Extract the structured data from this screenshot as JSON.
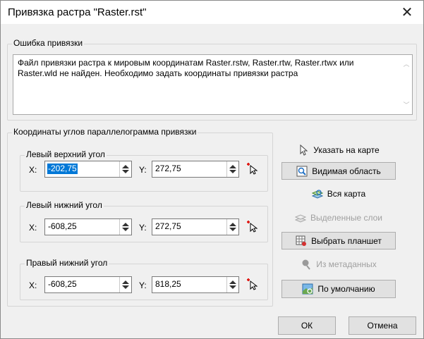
{
  "window": {
    "title": "Привязка растра \"Raster.rst\"",
    "close_label": "✕"
  },
  "error_group": {
    "legend": "Ошибка привязки",
    "message": "Файл привязки растра к мировым координатам Raster.rstw, Raster.rtw, Raster.rtwx или Raster.wld не найден.  Необходимо задать координаты привязки растра"
  },
  "coords_group": {
    "legend": "Координаты углов параллелограмма привязки",
    "corners": [
      {
        "legend": "Левый верхний угол",
        "x_label": "X:",
        "x_value": "-202,75",
        "y_label": "Y:",
        "y_value": "272,75"
      },
      {
        "legend": "Левый нижний угол",
        "x_label": "X:",
        "x_value": "-608,25",
        "y_label": "Y:",
        "y_value": "272,75"
      },
      {
        "legend": "Правый нижний угол",
        "x_label": "X:",
        "x_value": "-608,25",
        "y_label": "Y:",
        "y_value": "818,25"
      }
    ]
  },
  "buttons": {
    "point_on_map": "Указать на карте",
    "visible_area": "Видимая область",
    "whole_map": "Вся карта",
    "selected_layers": "Выделенные слои",
    "choose_sheet": "Выбрать планшет",
    "from_metadata": "Из метаданных",
    "default": "По умолчанию"
  },
  "footer": {
    "ok": "ОК",
    "cancel": "Отмена"
  },
  "colors": {
    "selection": "#0078d7",
    "disabled_text": "#a0a0a0"
  }
}
